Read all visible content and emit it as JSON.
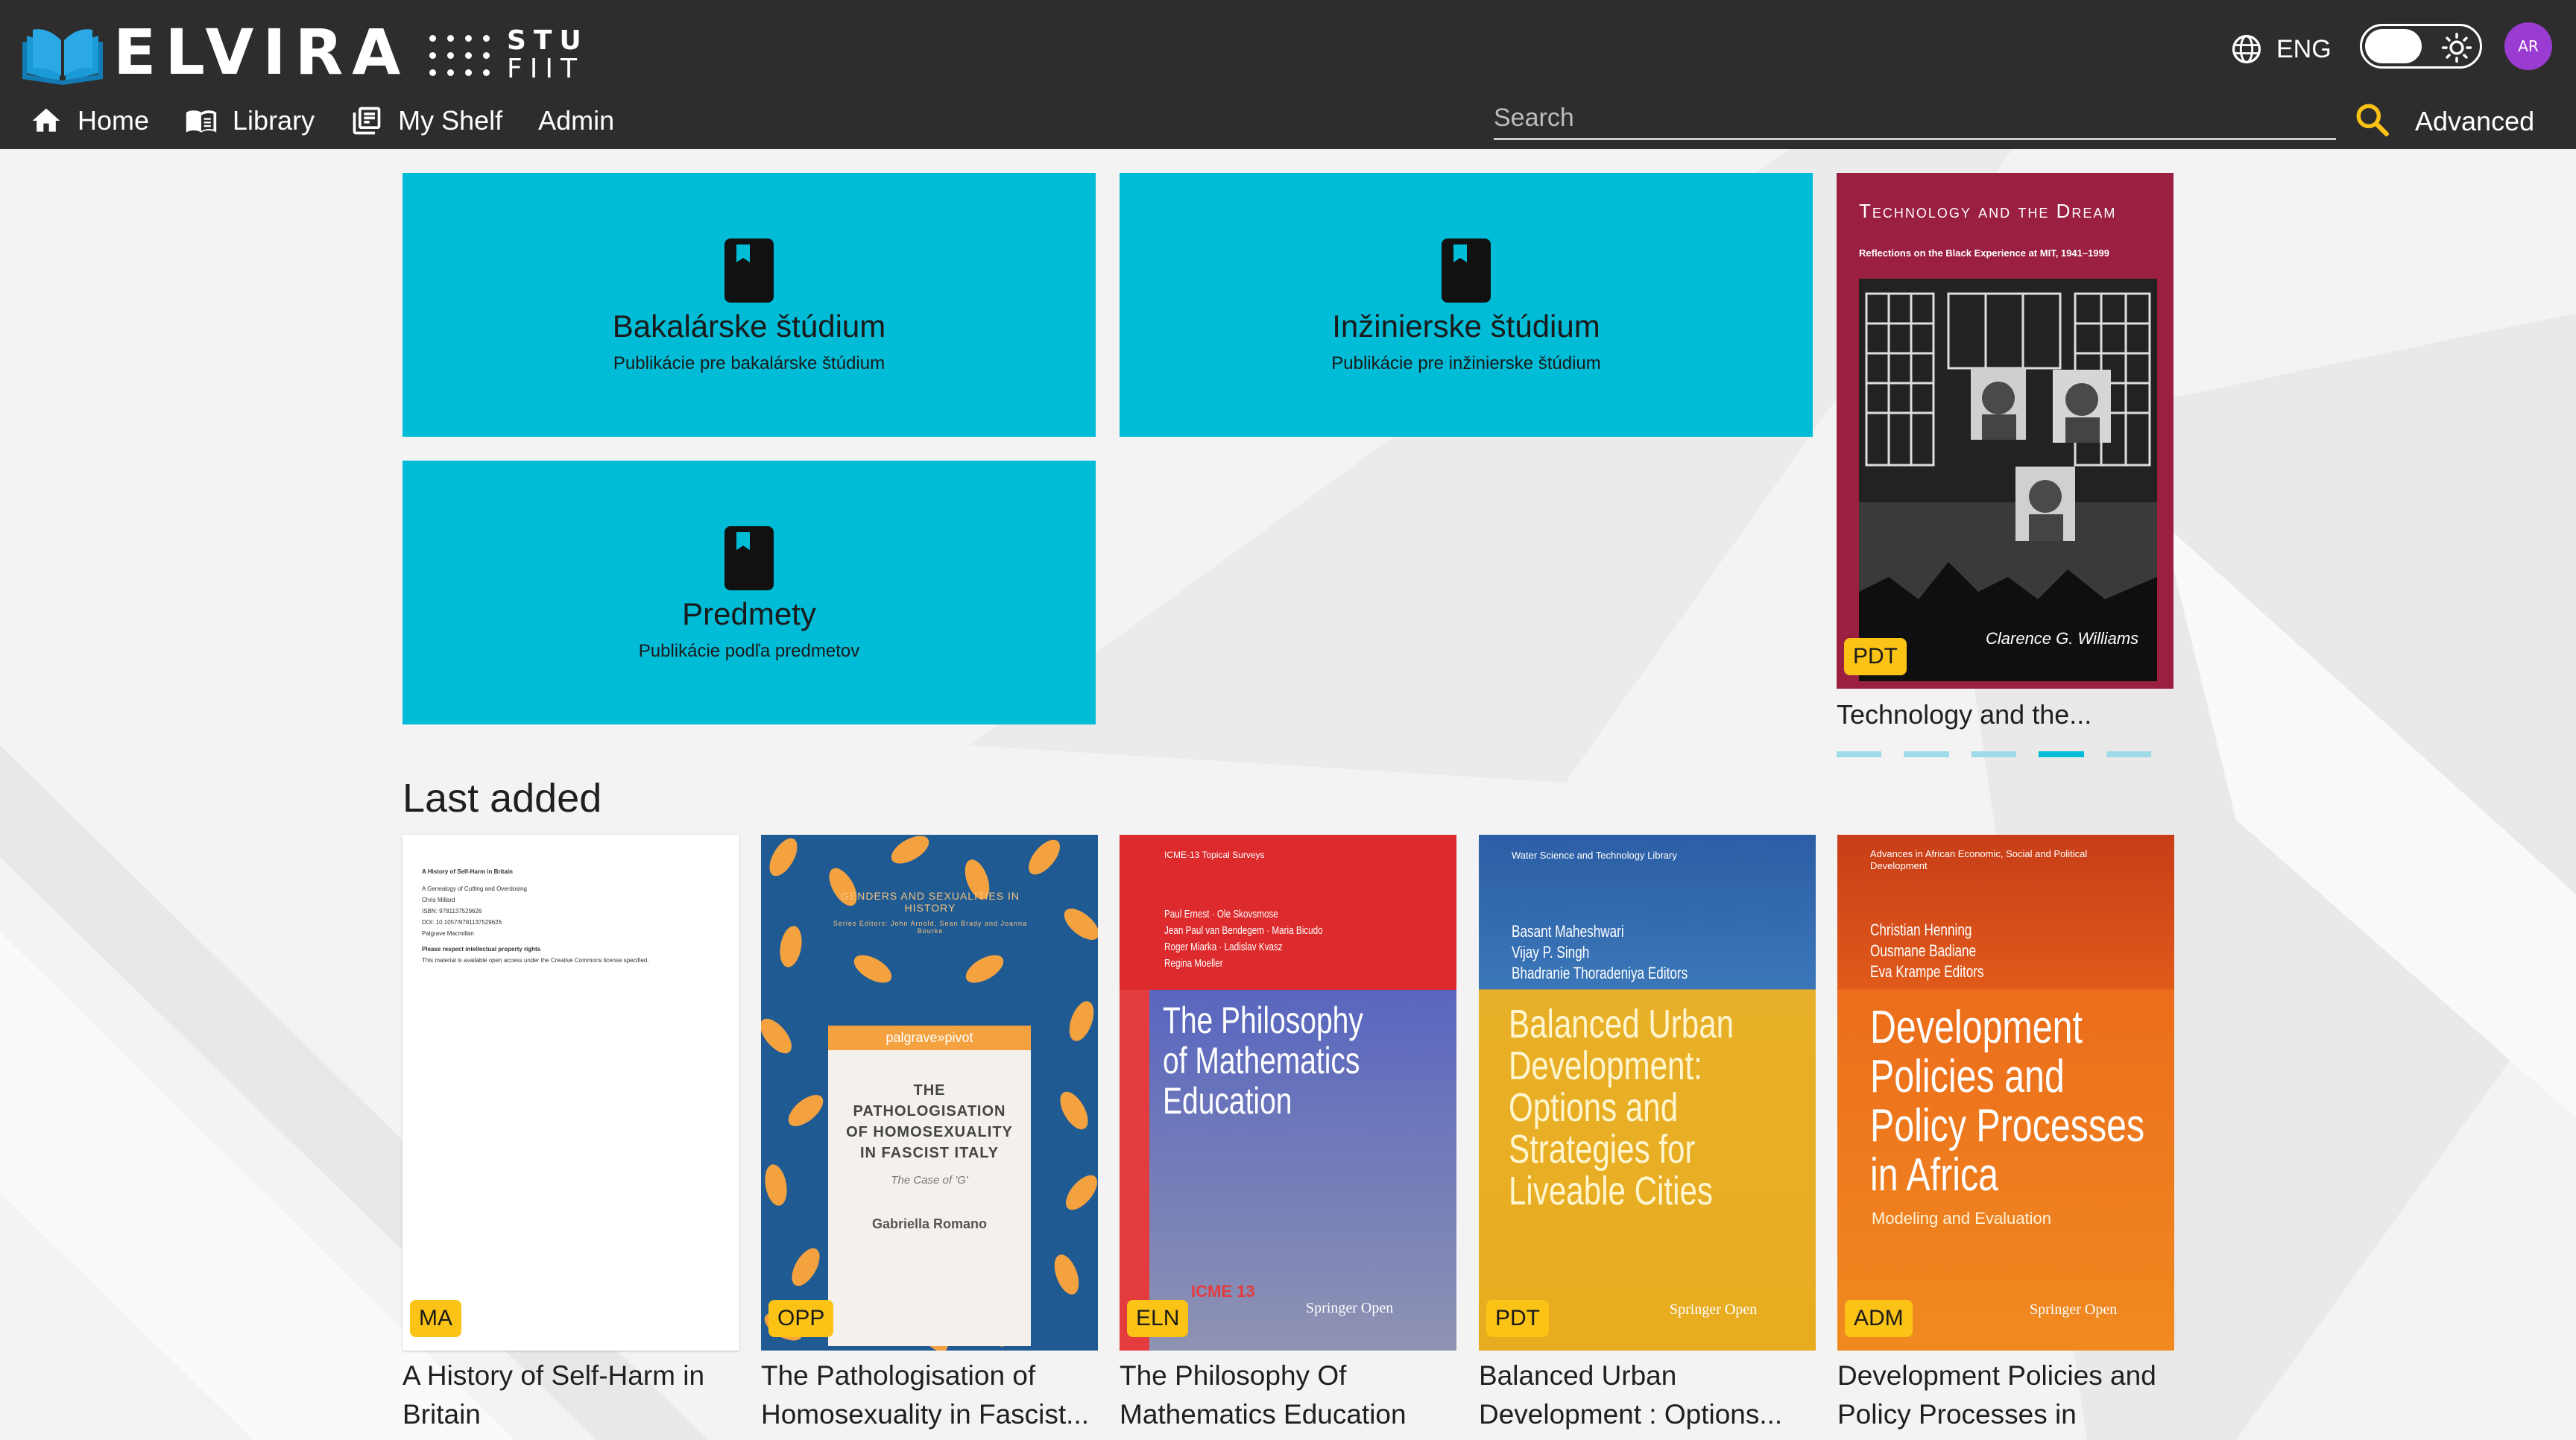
{
  "app": {
    "name": "ELVIRA",
    "partner_line1": "STU",
    "partner_line2": "FIIT"
  },
  "nav": {
    "home": "Home",
    "library": "Library",
    "my_shelf": "My Shelf",
    "admin": "Admin"
  },
  "search": {
    "placeholder": "Search",
    "advanced": "Advanced"
  },
  "user": {
    "language": "ENG",
    "avatar_initials": "AR"
  },
  "tiles": [
    {
      "title": "Bakalárske štúdium",
      "subtitle": "Publikácie pre bakalárske štúdium"
    },
    {
      "title": "Inžinierske štúdium",
      "subtitle": "Publikácie pre inžinierske štúdium"
    },
    {
      "title": "Predmety",
      "subtitle": "Publikácie podľa predmetov"
    }
  ],
  "carousel": {
    "cover_title": "Technology and the Dream",
    "cover_subtitle": "Reflections on the Black Experience at MIT, 1941–1999",
    "cover_author": "Clarence G. Williams",
    "badge": "PDT",
    "title": "Technology and the...",
    "active_slide": 4,
    "slide_count": 5
  },
  "last_added": {
    "heading": "Last added",
    "books": [
      {
        "title": "A History of Self-Harm in Britain",
        "badge": "MA",
        "cover_lines": [
          "A History of Self-Harm in Britain",
          "A Genealogy of Cutting and Overdosing",
          "Chris Millard",
          "ISBN: 9781137529626",
          "DOI: 10.1057/9781137529626",
          "Palgrave Macmillan",
          "Please respect intellectual property rights",
          "This material is available open access under the Creative Commons license specified."
        ]
      },
      {
        "title": "The Pathologisation of Homosexuality in Fascist...",
        "badge": "OPP",
        "series": "GENDERS AND SEXUALITIES IN HISTORY",
        "series_editors": "Series Editors: John Arnold, Sean Brady and Joanna Bourke",
        "publisher": "palgrave»pivot",
        "cover_title": "THE PATHOLOGISATION OF HOMOSEXUALITY IN FASCIST ITALY",
        "cover_subtitle": "The Case of 'G'",
        "cover_author": "Gabriella Romano"
      },
      {
        "title": "The Philosophy Of Mathematics Education",
        "badge": "ELN",
        "series": "ICME-13 Topical Surveys",
        "authors": [
          "Paul Ernest · Ole Skovsmose",
          "Jean Paul van Bendegem · Maria Bicudo",
          "Roger Miarka · Ladislav Kvasz",
          "Regina Moeller"
        ],
        "cover_title": [
          "The Philosophy",
          "of Mathematics",
          "Education"
        ],
        "publisher": "Springer Open",
        "conference": "ICME 13"
      },
      {
        "title": "Balanced Urban Development : Options...",
        "badge": "PDT",
        "series": "Water Science and Technology Library",
        "authors": [
          "Basant Maheshwari",
          "Vijay P. Singh",
          "Bhadranie Thoradeniya  Editors"
        ],
        "cover_title": [
          "Balanced Urban",
          "Development:",
          "Options and",
          "Strategies for",
          "Liveable Cities"
        ],
        "publisher": "Springer Open"
      },
      {
        "title": "Development Policies and Policy Processes in Africa...",
        "badge": "ADM",
        "series": "Advances in African Economic, Social and Political Development",
        "authors": [
          "Christian Henning",
          "Ousmane Badiane",
          "Eva Krampe  Editors"
        ],
        "cover_title": [
          "Development",
          "Policies and",
          "Policy Processes",
          "in Africa"
        ],
        "cover_subtitle": "Modeling and Evaluation",
        "publisher": "Springer Open"
      }
    ]
  },
  "colors": {
    "header_bg": "#2e2d2e",
    "tile_bg": "#00bcd7",
    "badge_bg": "#fbc316",
    "avatar_bg": "#9a3bd1",
    "search_icon": "#fbc316"
  }
}
